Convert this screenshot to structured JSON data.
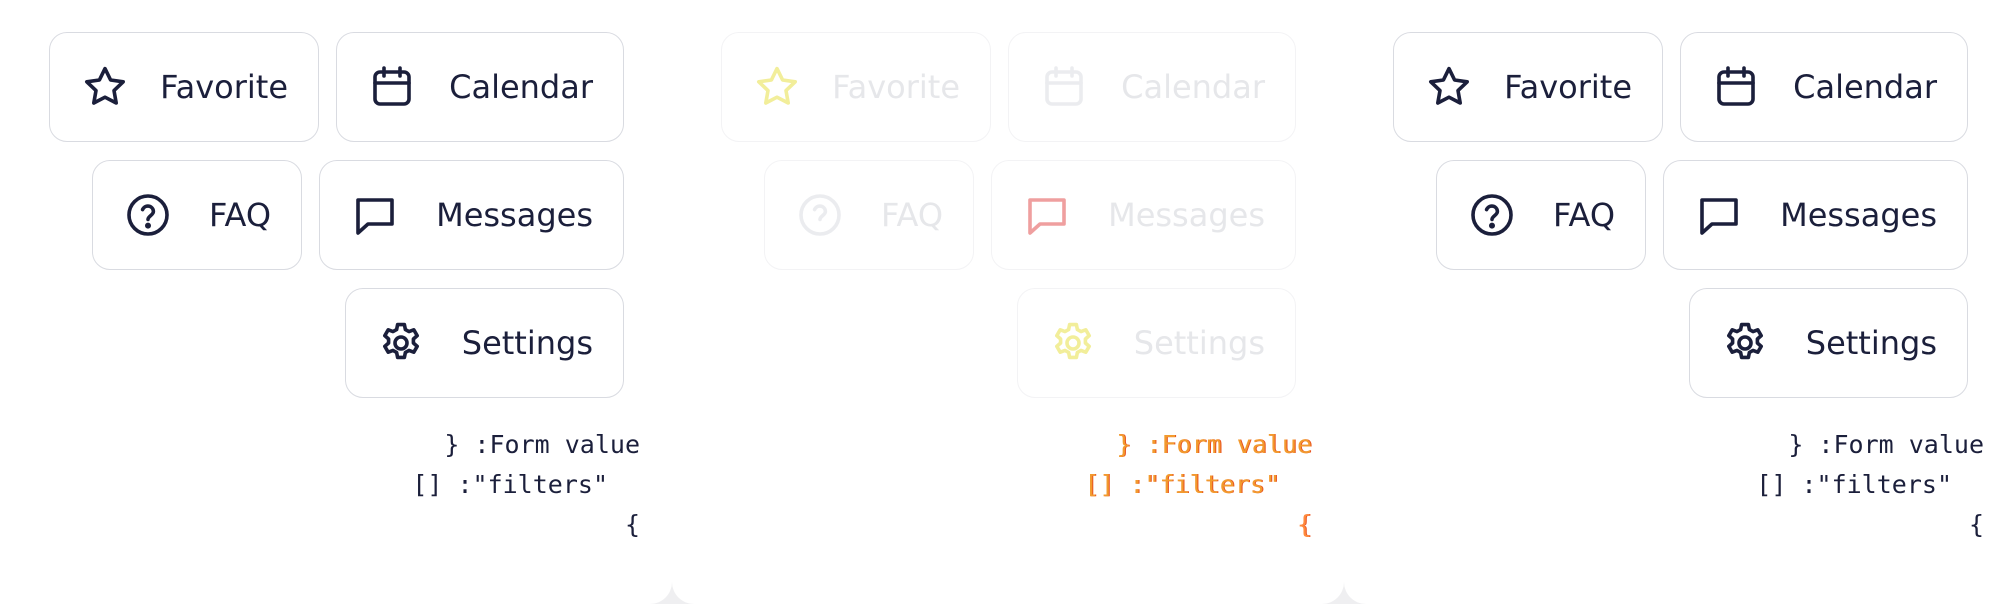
{
  "panels": [
    {
      "id": "left",
      "buttons": {
        "favorite": {
          "label": "Favorite",
          "icon": "star-icon"
        },
        "calendar": {
          "label": "Calendar",
          "icon": "calendar-icon"
        },
        "faq": {
          "label": "FAQ",
          "icon": "question-circle-icon"
        },
        "messages": {
          "label": "Messages",
          "icon": "message-square-icon"
        },
        "settings": {
          "label": "Settings",
          "icon": "gear-icon"
        }
      },
      "form_value": {
        "line1": "} :Form value",
        "line2": "[] :\"filters\"",
        "line3": "{"
      }
    },
    {
      "id": "middle",
      "state": "faded",
      "buttons": {
        "favorite": {
          "label": "Favorite",
          "icon": "star-icon"
        },
        "calendar": {
          "label": "Calendar",
          "icon": "calendar-icon"
        },
        "faq": {
          "label": "FAQ",
          "icon": "question-circle-icon"
        },
        "messages": {
          "label": "Messages",
          "icon": "message-square-icon"
        },
        "settings": {
          "label": "Settings",
          "icon": "gear-icon"
        }
      },
      "form_value": {
        "line1": "} :Form value",
        "line2": "[] :\"filters\"",
        "line3": "{"
      }
    },
    {
      "id": "right",
      "buttons": {
        "favorite": {
          "label": "Favorite",
          "icon": "star-icon"
        },
        "calendar": {
          "label": "Calendar",
          "icon": "calendar-icon"
        },
        "faq": {
          "label": "FAQ",
          "icon": "question-circle-icon"
        },
        "messages": {
          "label": "Messages",
          "icon": "message-square-icon"
        },
        "settings": {
          "label": "Settings",
          "icon": "gear-icon"
        }
      },
      "form_value": {
        "line1": "} :Form value",
        "line2": "[] :\"filters\"",
        "line3": "{"
      }
    }
  ],
  "colors": {
    "text": "#1b1f3b",
    "border": "#d9dbe1",
    "background": "#efeff1",
    "panel": "#ffffff",
    "faded_text": "#e6e7ea",
    "faded_icon_yellow": "#f2ee9a",
    "faded_icon_red": "#ef9f9f",
    "faded_code": "#f29a2e"
  }
}
